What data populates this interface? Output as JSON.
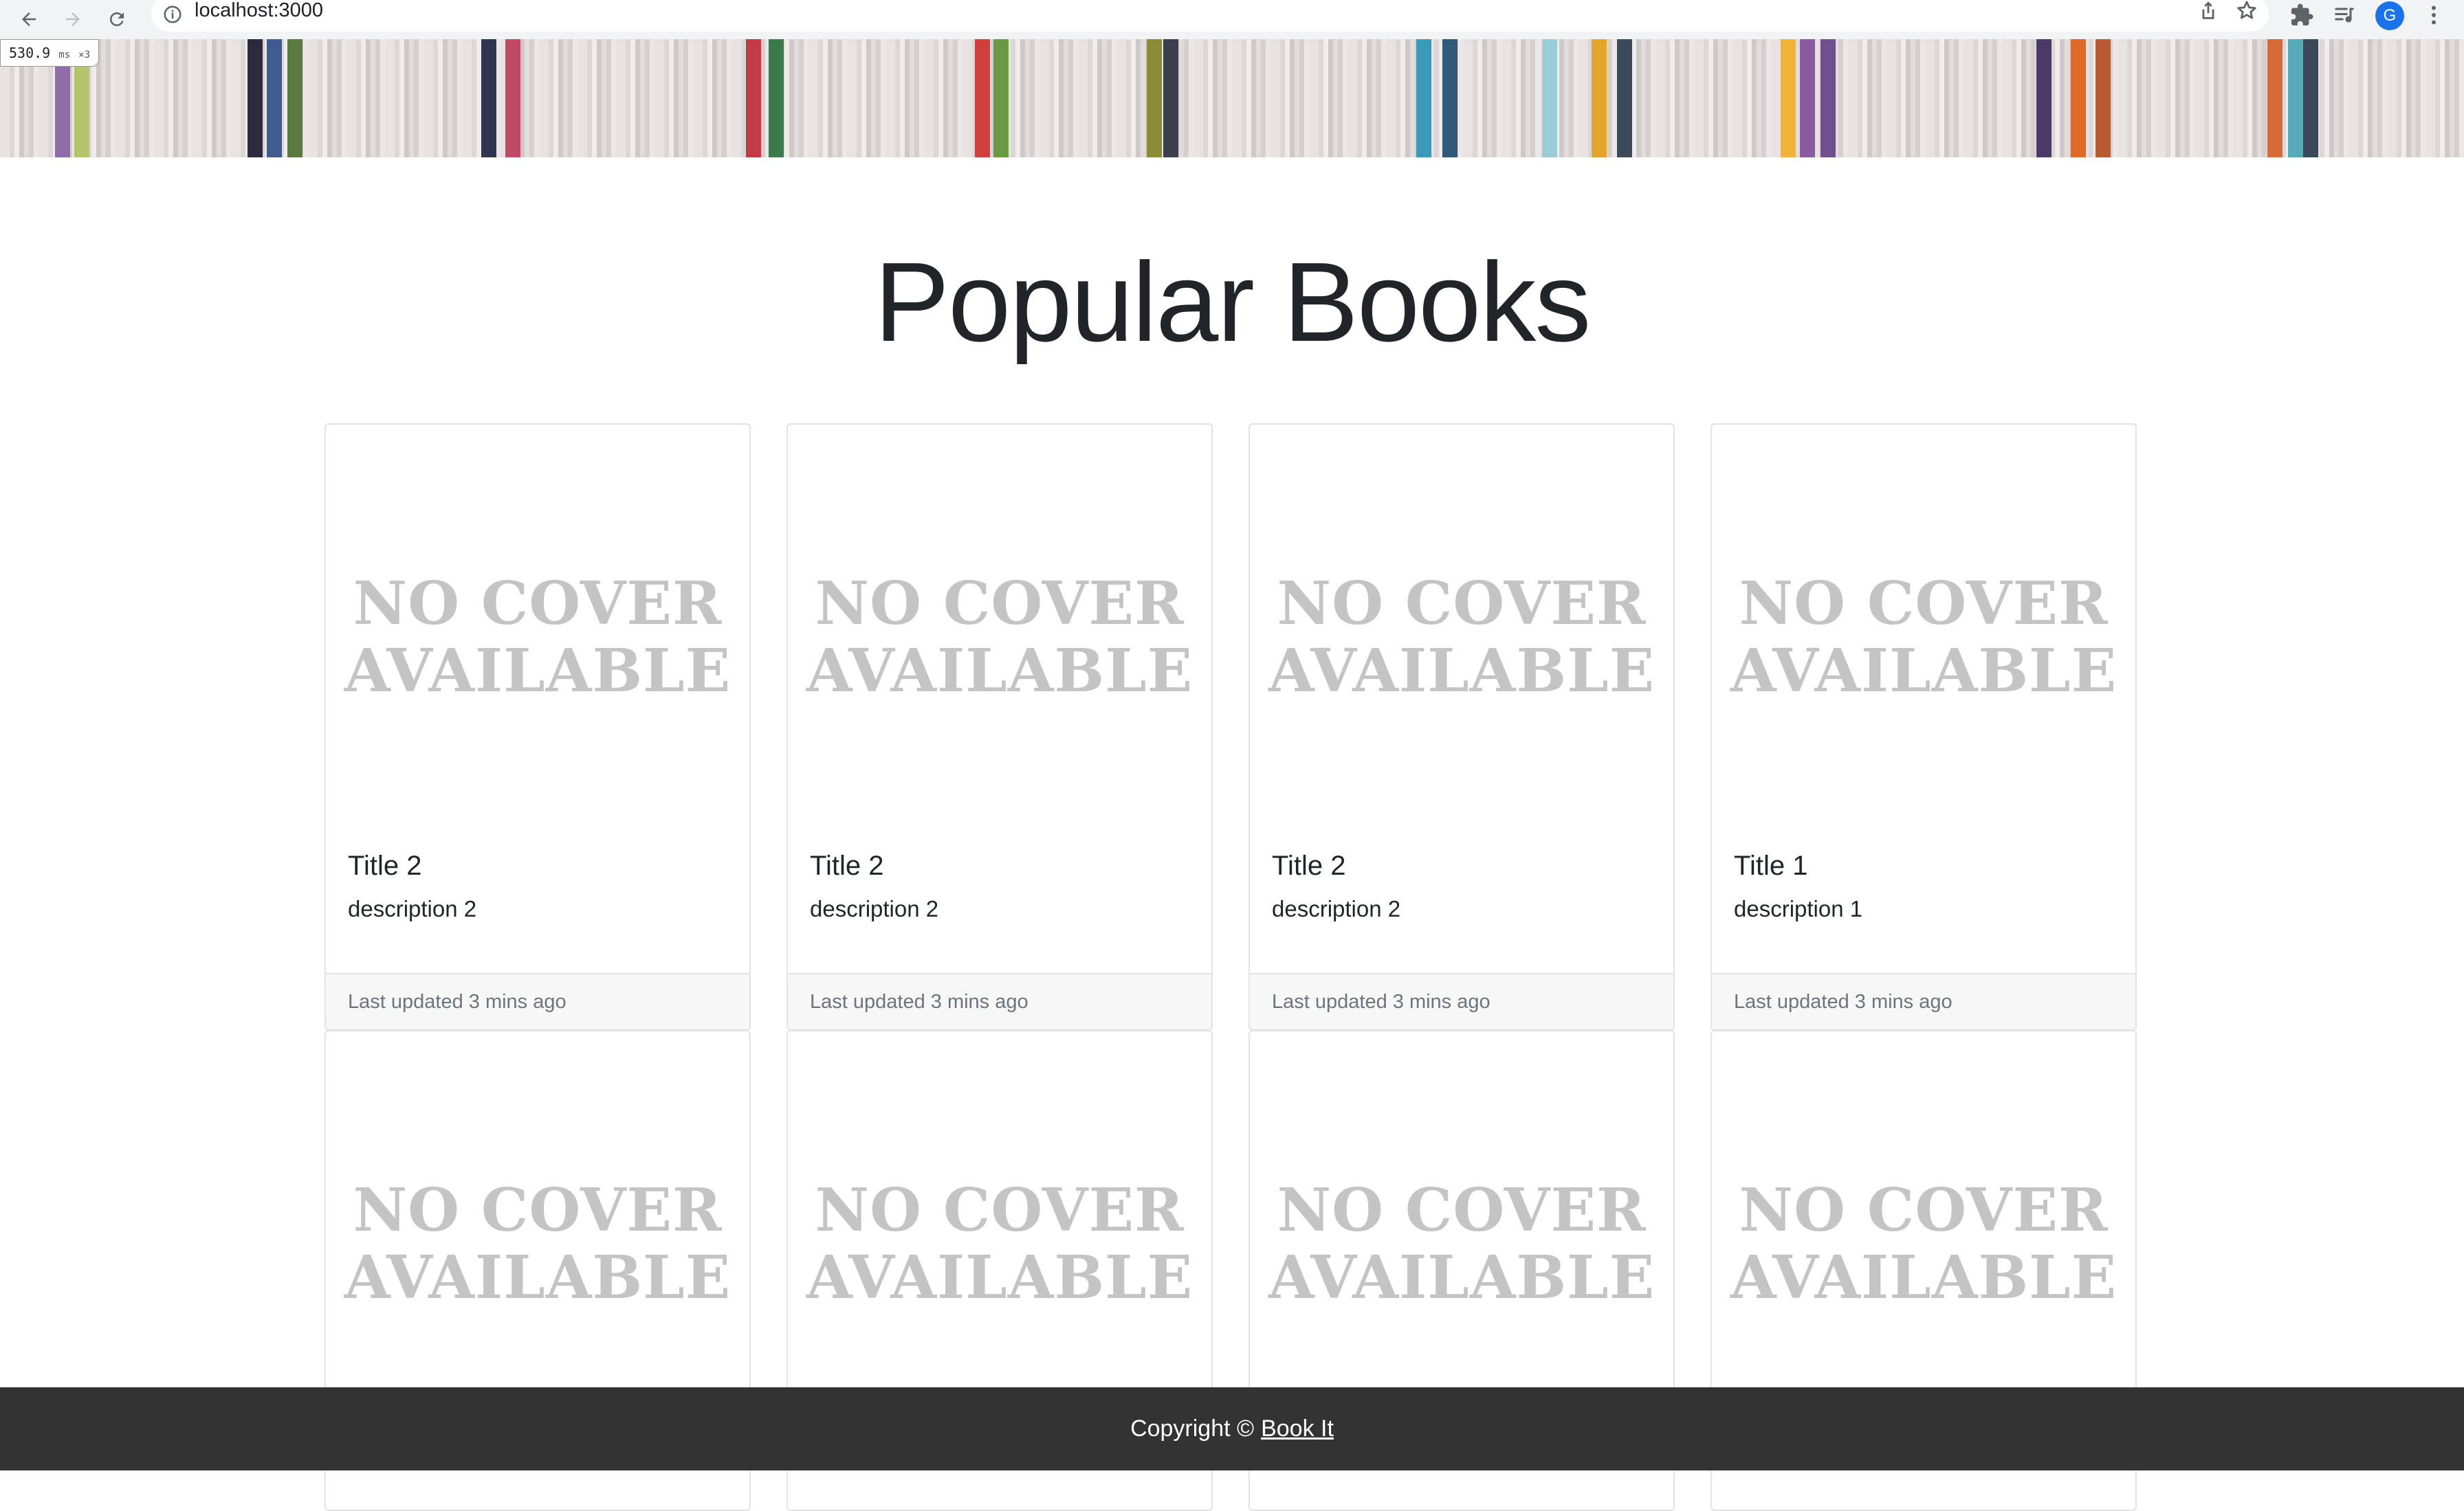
{
  "browser": {
    "url": "localhost:3000",
    "perf_value": "530.9",
    "perf_unit": "ms",
    "perf_mult": "×3",
    "avatar_letter": "G"
  },
  "page": {
    "title": "Popular Books"
  },
  "cards": [
    {
      "cover": [
        "NO COVER",
        "AVAILABLE"
      ],
      "title": "Title 2",
      "description": "description 2",
      "updated": "Last updated 3 mins ago"
    },
    {
      "cover": [
        "NO COVER",
        "AVAILABLE"
      ],
      "title": "Title 2",
      "description": "description 2",
      "updated": "Last updated 3 mins ago"
    },
    {
      "cover": [
        "NO COVER",
        "AVAILABLE"
      ],
      "title": "Title 2",
      "description": "description 2",
      "updated": "Last updated 3 mins ago"
    },
    {
      "cover": [
        "NO COVER",
        "AVAILABLE"
      ],
      "title": "Title 1",
      "description": "description 1",
      "updated": "Last updated 3 mins ago"
    },
    {
      "cover": [
        "NO COVER",
        "AVAILABLE"
      ]
    },
    {
      "cover": [
        "NO COVER",
        "AVAILABLE"
      ]
    },
    {
      "cover": [
        "NO COVER",
        "AVAILABLE"
      ]
    },
    {
      "cover": [
        "NO COVER",
        "AVAILABLE"
      ]
    }
  ],
  "footer": {
    "copyright": "Copyright ©",
    "link": "Book It"
  }
}
